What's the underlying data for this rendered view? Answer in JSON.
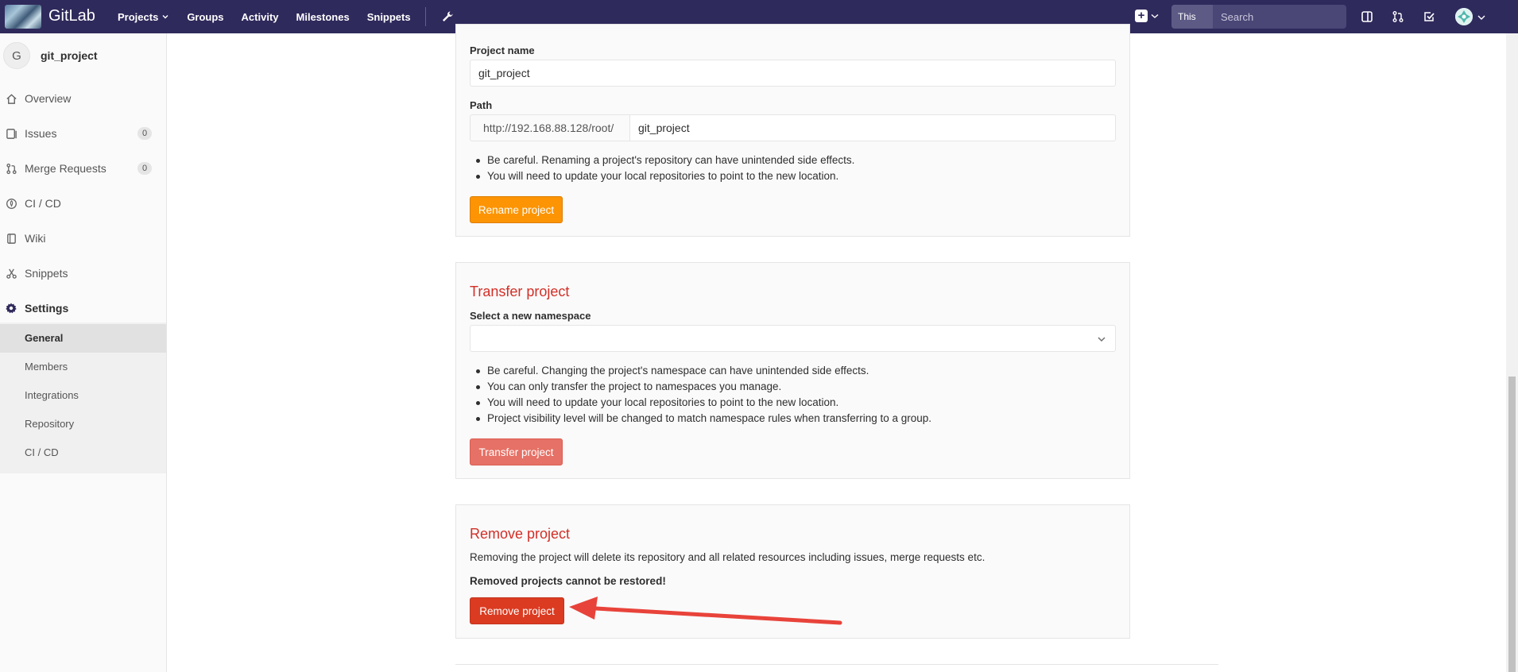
{
  "navbar": {
    "brand": "GitLab",
    "links": [
      "Projects",
      "Groups",
      "Activity",
      "Milestones",
      "Snippets"
    ],
    "search_scope": "This project",
    "search_placeholder": "Search"
  },
  "sidebar": {
    "project_avatar_letter": "G",
    "project_name": "git_project",
    "items": [
      {
        "label": "Overview",
        "icon": "home-icon"
      },
      {
        "label": "Issues",
        "icon": "issues-icon",
        "badge": "0"
      },
      {
        "label": "Merge Requests",
        "icon": "merge-request-icon",
        "badge": "0"
      },
      {
        "label": "CI / CD",
        "icon": "rocket-icon"
      },
      {
        "label": "Wiki",
        "icon": "book-icon"
      },
      {
        "label": "Snippets",
        "icon": "scissors-icon"
      },
      {
        "label": "Settings",
        "icon": "settings-icon"
      }
    ],
    "settings_subitems": [
      "General",
      "Members",
      "Integrations",
      "Repository",
      "CI / CD"
    ]
  },
  "rename": {
    "project_name_label": "Project name",
    "project_name_value": "git_project",
    "path_label": "Path",
    "path_prefix": "http://192.168.88.128/root/",
    "path_value": "git_project",
    "notes": [
      "Be careful. Renaming a project's repository can have unintended side effects.",
      "You will need to update your local repositories to point to the new location."
    ],
    "button": "Rename project"
  },
  "transfer": {
    "title": "Transfer project",
    "namespace_label": "Select a new namespace",
    "notes": [
      "Be careful. Changing the project's namespace can have unintended side effects.",
      "You can only transfer the project to namespaces you manage.",
      "You will need to update your local repositories to point to the new location.",
      "Project visibility level will be changed to match namespace rules when transferring to a group."
    ],
    "button": "Transfer project"
  },
  "remove": {
    "title": "Remove project",
    "description": "Removing the project will delete its repository and all related resources including issues, merge requests etc.",
    "warning": "Removed projects cannot be restored!",
    "button": "Remove project"
  },
  "colors": {
    "navbar": "#2f2a5c",
    "danger": "#db3b21",
    "warning": "#fc9403",
    "annotation_arrow": "#e8433a"
  }
}
